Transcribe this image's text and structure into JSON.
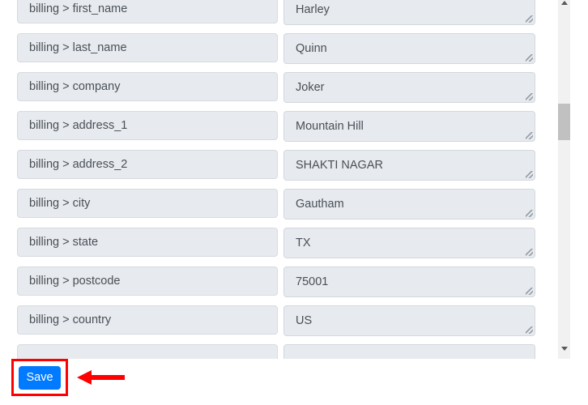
{
  "panel": {
    "name": "field-mapping-panel",
    "rows": [
      {
        "source": "billing > first_name",
        "value": "Harley"
      },
      {
        "source": "billing > last_name",
        "value": "Quinn"
      },
      {
        "source": "billing > company",
        "value": "Joker"
      },
      {
        "source": "billing > address_1",
        "value": "Mountain Hill"
      },
      {
        "source": "billing > address_2",
        "value": "SHAKTI NAGAR"
      },
      {
        "source": "billing > city",
        "value": "Gautham"
      },
      {
        "source": "billing > state",
        "value": "TX"
      },
      {
        "source": "billing > postcode",
        "value": "75001"
      },
      {
        "source": "billing > country",
        "value": "US"
      },
      {
        "source": "",
        "value": ""
      }
    ]
  },
  "scrollbar": {
    "up_arrow_icon": "chevron-up-icon",
    "down_arrow_icon": "chevron-down-icon"
  },
  "toolbar": {
    "save_label": "Save"
  },
  "annotation": {
    "arrow_icon": "left-arrow-annotation",
    "highlight_color": "#ff0000",
    "accent_color": "#007bff"
  }
}
